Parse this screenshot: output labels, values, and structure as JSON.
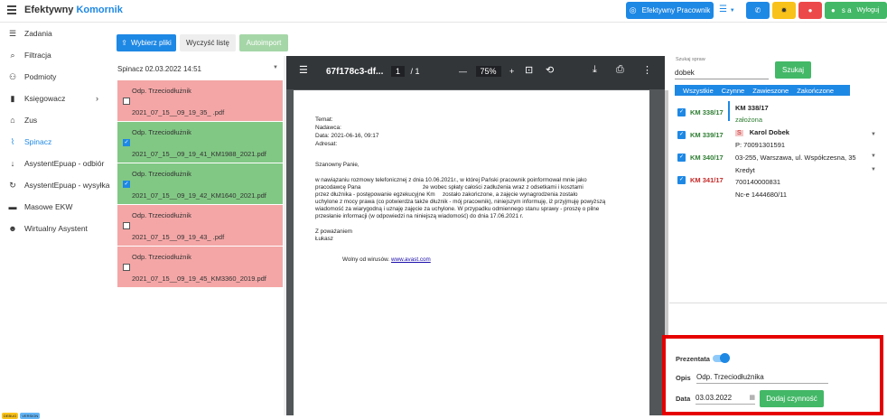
{
  "app": {
    "title_main": "Efektywny",
    "title_accent": "Komornik"
  },
  "topbar": {
    "efektywny_pracownik": "Efektywny Pracownik",
    "user": "s a",
    "logout": "Wyloguj"
  },
  "sidebar": {
    "items": [
      {
        "label": "Zadania"
      },
      {
        "label": "Filtracja"
      },
      {
        "label": "Podmioty"
      },
      {
        "label": "Księgowacz"
      },
      {
        "label": "Zus"
      },
      {
        "label": "Spinacz"
      },
      {
        "label": "AsystentEpuap - odbiór"
      },
      {
        "label": "AsystentEpuap - wysyłka"
      },
      {
        "label": "Masowe EKW"
      },
      {
        "label": "Wirtualny Asystent"
      }
    ],
    "badge_debug": "DEBUG",
    "badge_version": "VERSION"
  },
  "actions": {
    "choose_files": "Wybierz pliki",
    "clear_list": "Wyczyść listę",
    "autoimport": "Autoimport"
  },
  "file_select": {
    "value": "Spinacz 02.03.2022 14:51"
  },
  "files": [
    {
      "title": "Odp. Trzeciodłużnik",
      "name": "2021_07_15__09_19_35_                    .pdf",
      "checked": ""
    },
    {
      "title": "Odp. Trzeciodłużnik",
      "name": "2021_07_15__09_19_41_KM1988_2021.pdf",
      "checked": "✓"
    },
    {
      "title": "Odp. Trzeciodłużnik",
      "name": "2021_07_15__09_19_42_KM1640_2021.pdf",
      "checked": "✓"
    },
    {
      "title": "Odp. Trzeciodłużnik",
      "name": "2021_07_15__09_19_43_                    .pdf",
      "checked": ""
    },
    {
      "title": "Odp. Trzeciodłużnik",
      "name": "2021_07_15__09_19_45_KM3360_2019.pdf",
      "checked": ""
    }
  ],
  "pdf": {
    "title": "67f178c3-df...",
    "page_current": "1",
    "page_total": "/ 1",
    "zoom": "75%",
    "lines": {
      "temat": "Temat:",
      "nadawca": "Nadawca:",
      "data": "Data: 2021-06-16, 09:17",
      "adresat": "Adresat:",
      "greeting": "Szanowny Panie,",
      "b1": "w nawiązaniu rozmowy telefonicznej z dnia 10.06.2021r., w której Pański pracownik poinformował mnie jako",
      "b2a": "pracodawcę Pana",
      "b2b": "że wobec spłaty całości zadłużenia wraz z odsetkami i kosztami",
      "b3a": "przez dłużnika - postępowanie egzekucyjne Km",
      "b3b": "zostało zakończone, a zajęcie wynagrodzenia zostało",
      "b4": "uchylone z mocy prawa (co potwierdza także dłużnik - mój pracownik), niniejszym informuję, iż przyjmuję powyższą",
      "b5": "wiadomość za wiarygodną i uznaję zajęcie za uchylone. W przypadku odmiennego stanu sprawy - proszę o pilne",
      "b6": "przesłanie informacji (w odpowiedzi na niniejszą wiadomość) do dnia 17.06.2021 r.",
      "regards": "Z poważaniem",
      "sign": "Łukasz",
      "virus": "Wolny od wirusów.",
      "virus_link": "www.avast.com"
    }
  },
  "search": {
    "label": "Szukaj spraw",
    "value": "dobek",
    "button": "Szukaj",
    "tabs": [
      "Wszystkie",
      "Czynne",
      "Zawieszone",
      "Zakończone"
    ]
  },
  "cases": [
    {
      "num": "KM 338/17",
      "color": "#2e7d32"
    },
    {
      "num": "KM 339/17",
      "color": "#2e7d32"
    },
    {
      "num": "KM 340/17",
      "color": "#2e7d32"
    },
    {
      "num": "KM 341/17",
      "color": "#c62828"
    }
  ],
  "case_detail": {
    "num": "KM 338/17",
    "status": "założona",
    "badge": "S",
    "name": "Karol Dobek",
    "pesel": "P: 70091301591",
    "address": "03-255, Warszawa, ul. Współczesna, 35",
    "type": "Kredyt",
    "account": "700140000831",
    "nc": "Nc-e 1444680/11"
  },
  "form": {
    "prezentata": "Prezentata",
    "opis_label": "Opis",
    "opis_value": "Odp. Trzeciodłużnika",
    "data_label": "Data",
    "data_value": "03.03.2022",
    "add_button": "Dodaj czynność"
  },
  "colors": {
    "primary": "#1e88e5",
    "success": "#43b867",
    "file_red": "#f4a6a6",
    "file_green": "#81c884",
    "highlight_border": "#e60000"
  }
}
